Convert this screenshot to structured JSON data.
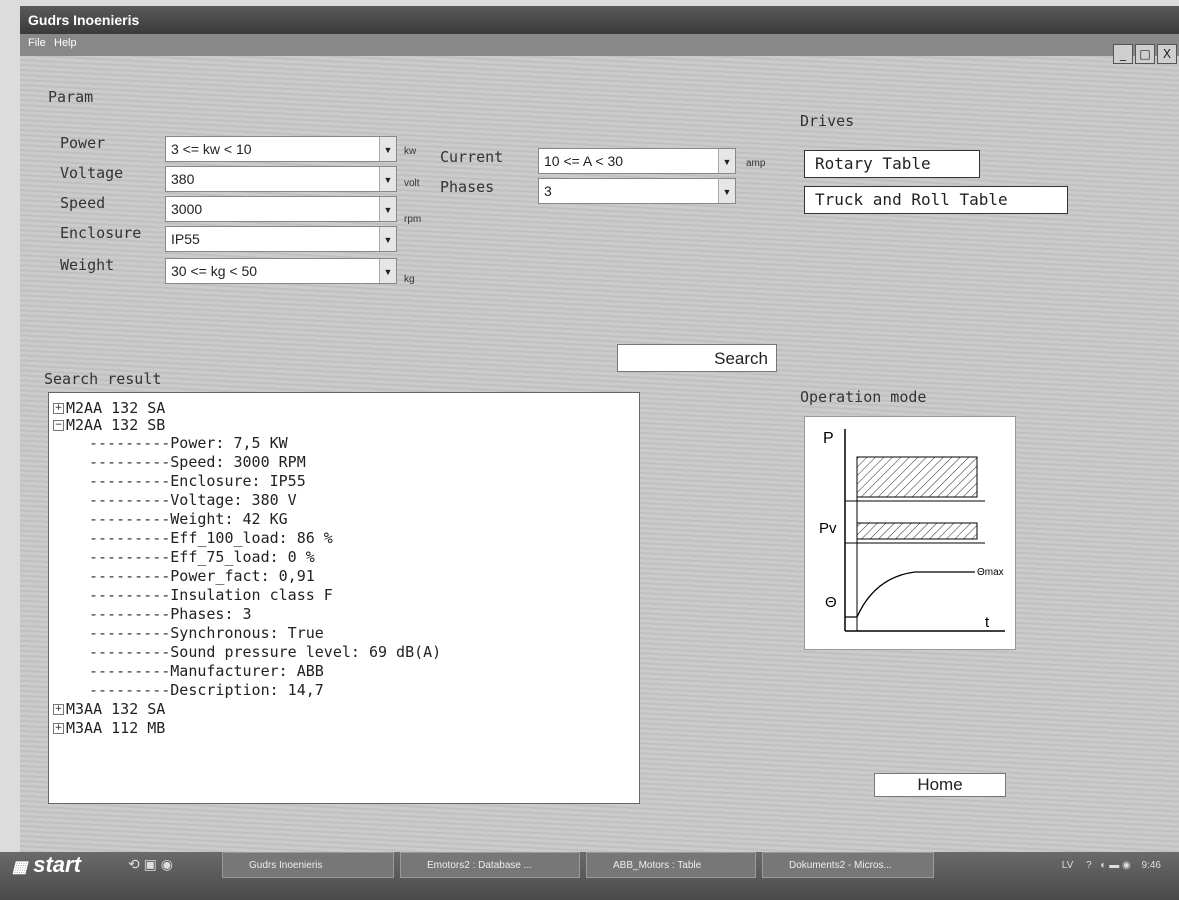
{
  "window": {
    "title": "Gudrs Inoenieris",
    "menu": [
      "File",
      "Help"
    ],
    "controls": [
      "_",
      "□",
      "X"
    ]
  },
  "param": {
    "section": "Param",
    "fields": [
      {
        "label": "Power",
        "value": "3 <= kw < 10",
        "unit": "kw"
      },
      {
        "label": "Voltage",
        "value": "380",
        "unit": "volt"
      },
      {
        "label": "Speed",
        "value": "3000",
        "unit": "rpm"
      },
      {
        "label": "Enclosure",
        "value": "IP55",
        "unit": ""
      },
      {
        "label": "Weight",
        "value": "30 <= kg < 50",
        "unit": "kg"
      }
    ],
    "current": {
      "label": "Current",
      "value": "10 <= A < 30",
      "unit": "amp"
    },
    "phases": {
      "label": "Phases",
      "value": "3"
    }
  },
  "drives": {
    "title": "Drives",
    "buttons": [
      "Rotary Table",
      "Truck and Roll Table"
    ]
  },
  "search_label": "Search",
  "results": {
    "title": "Search result",
    "items": [
      {
        "name": "M2AA 132 SA"
      },
      {
        "name": "M2AA 132 SB"
      },
      {
        "name": "M3AA 132 SA"
      },
      {
        "name": "M3AA 112 MB"
      }
    ],
    "details": [
      "Power: 7,5 KW",
      "Speed: 3000 RPM",
      "Enclosure: IP55",
      "Voltage: 380 V",
      "Weight: 42 KG",
      "Eff_100_load: 86 %",
      "Eff_75_load: 0 %",
      "Power_fact: 0,91",
      "Insulation class F",
      "Phases: 3",
      "Synchronous: True",
      "Sound pressure level: 69 dB(A)",
      "Manufacturer: ABB",
      "Description: 14,7"
    ]
  },
  "operation": {
    "title": "Operation mode",
    "labels": {
      "p": "P",
      "pv": "Pv",
      "theta": "Θ",
      "thetamax": "Θmax",
      "t": "t"
    }
  },
  "home_label": "Home",
  "taskbar": {
    "start": "start",
    "tasks": [
      "Gudrs Inoenieris",
      "Emotors2 : Database ...",
      "ABB_Motors : Table",
      "Dokuments2 - Micros..."
    ],
    "lang": "LV",
    "time": "9:46"
  }
}
